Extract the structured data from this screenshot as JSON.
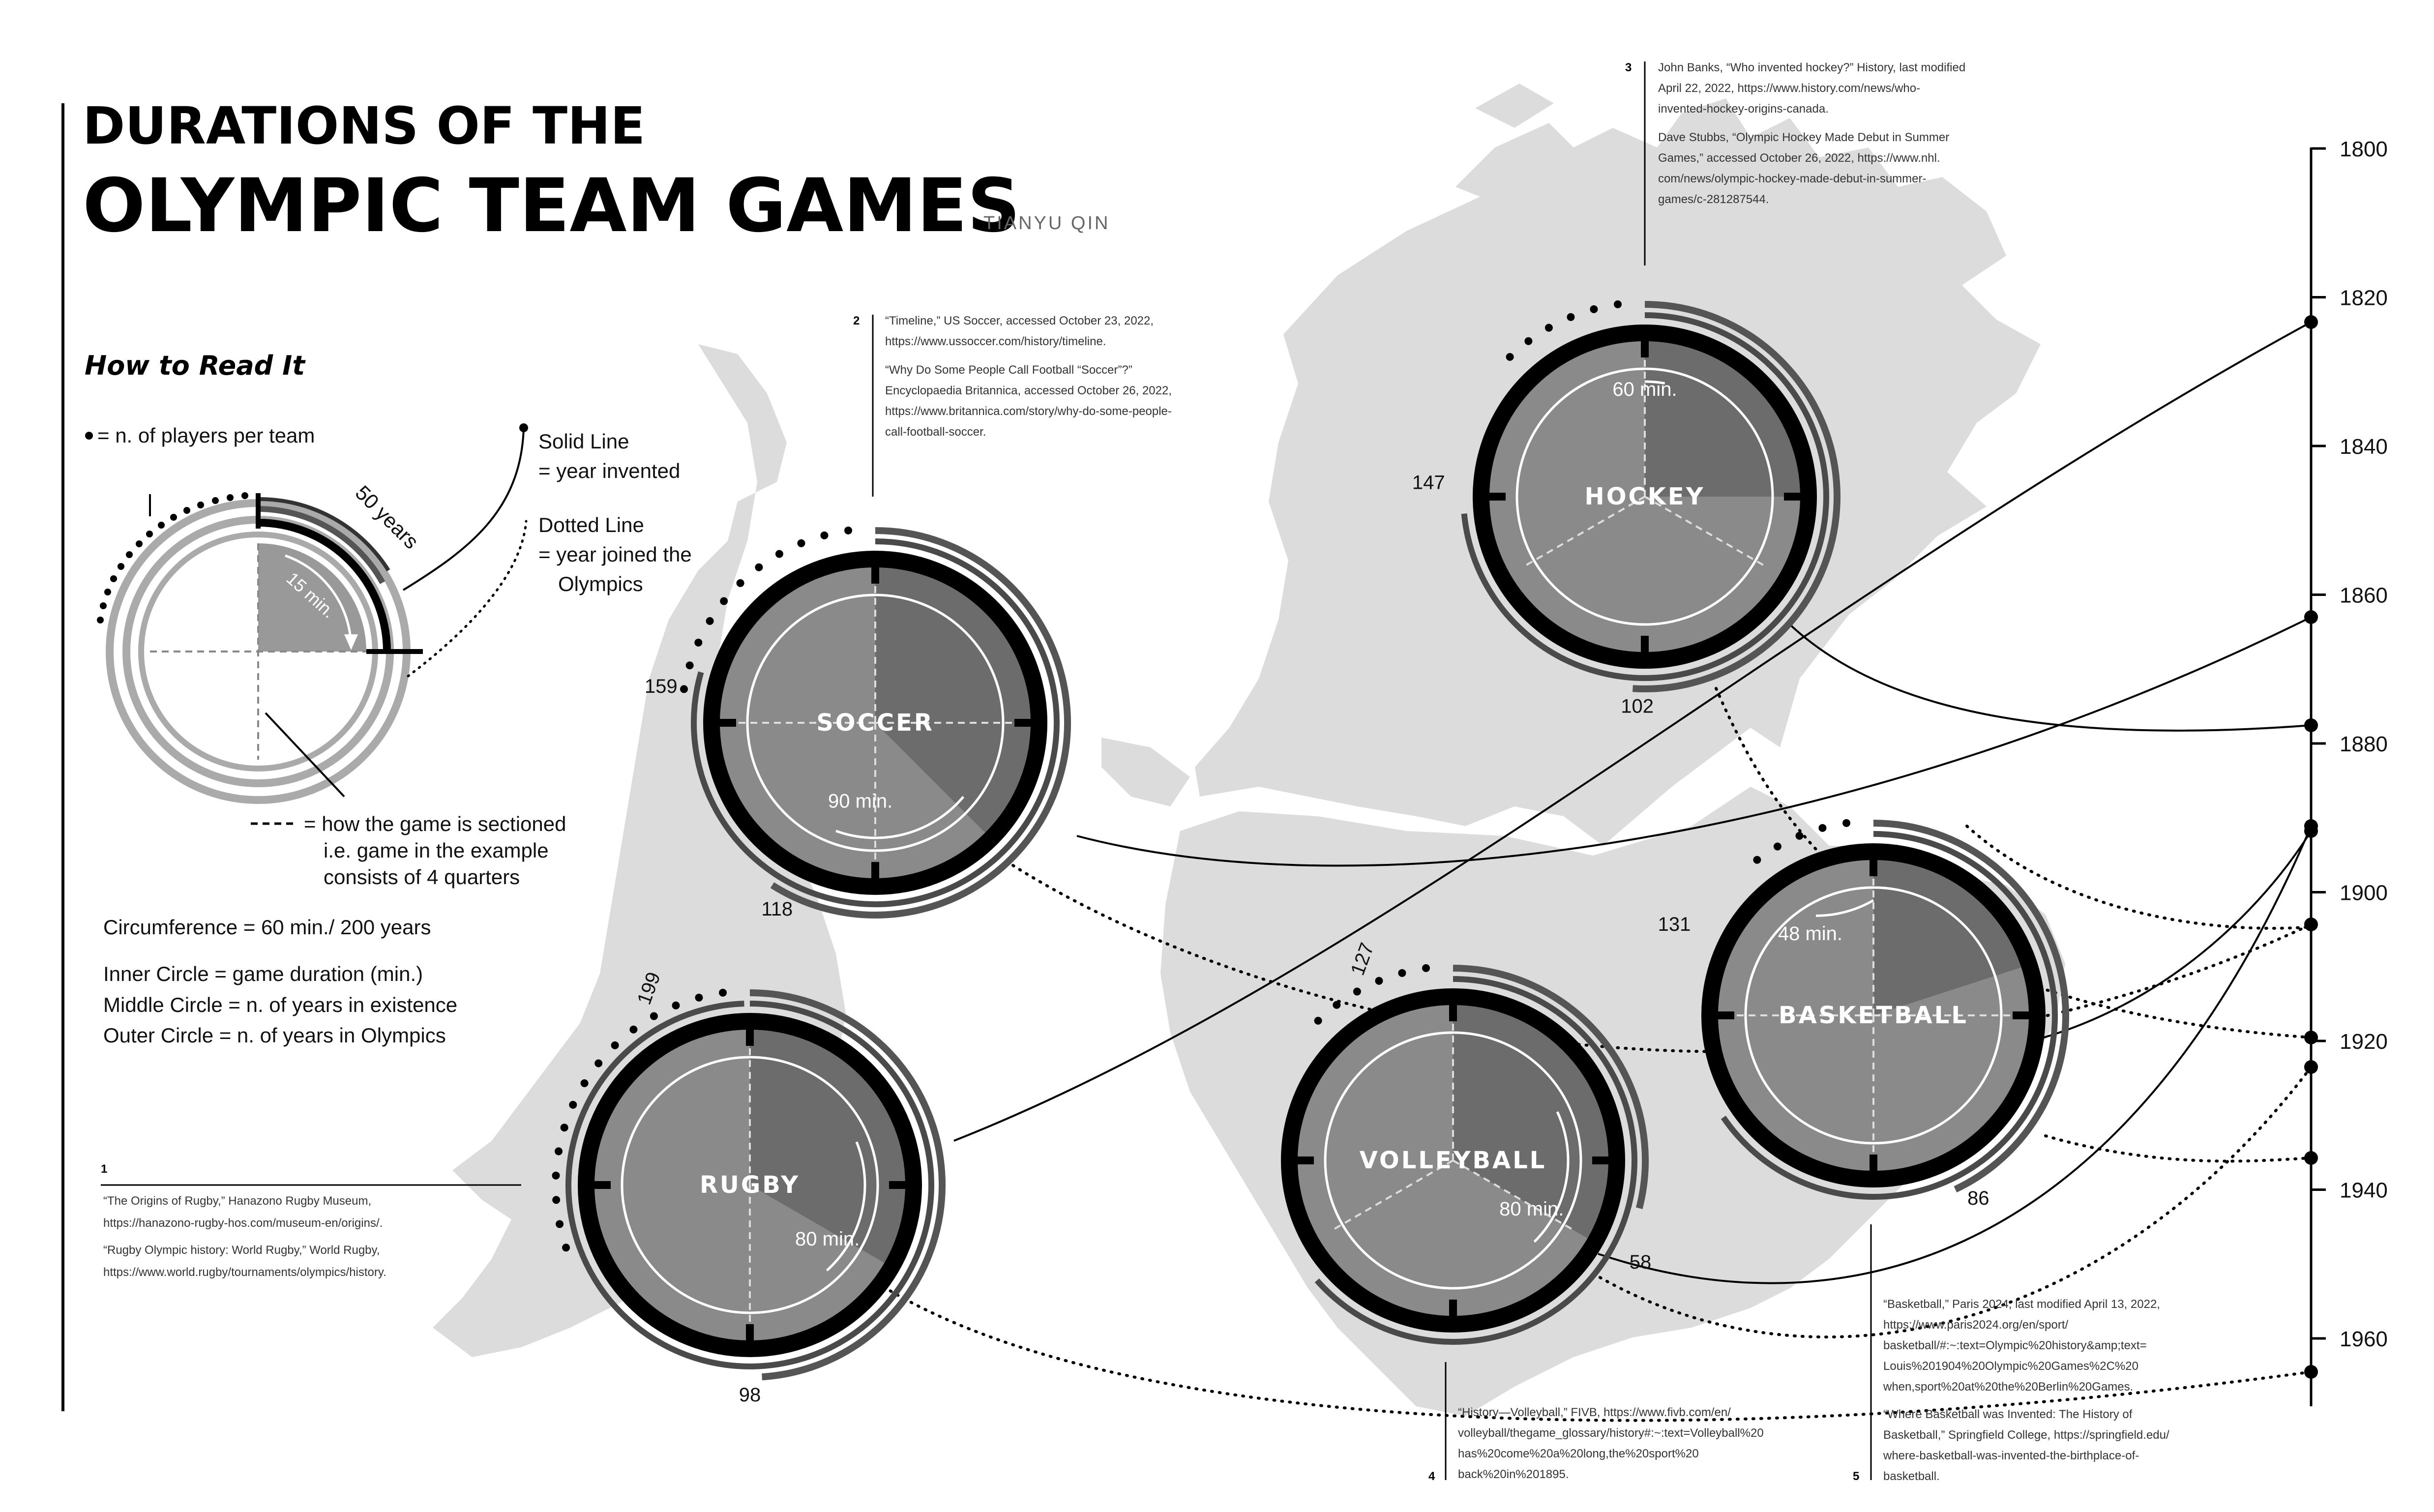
{
  "title": {
    "line1": "DURATIONS OF THE",
    "line2": "OLYMPIC TEAM GAMES",
    "author": "TIANYU QIN"
  },
  "how_to": {
    "heading": "How to Read It",
    "players": "= n. of players per team",
    "solid_line_1": "Solid Line",
    "solid_line_2": "= year invented",
    "dotted_line_1": "Dotted Line",
    "dotted_line_2": "= year joined the",
    "dotted_line_3": "Olympics",
    "sectioned_1": "= how the game is sectioned",
    "sectioned_2": "i.e.  game in the example",
    "sectioned_3": "consists of 4 quarters",
    "circumference": "Circumference =  60 min./ 200 years",
    "inner": "Inner  Circle = game duration (min.)",
    "middle": "Middle Circle = n. of years in existence",
    "outer": "Outer Circle = n. of years in Olympics",
    "example_years": "50 years",
    "example_min": "15 min."
  },
  "games": [
    {
      "name": "SOCCER",
      "duration": "90 min.",
      "existence": "159",
      "olympics": "118"
    },
    {
      "name": "HOCKEY",
      "duration": "60 min.",
      "existence": "147",
      "olympics": "102"
    },
    {
      "name": "RUGBY",
      "duration": "80 min.",
      "existence": "199",
      "olympics": "98"
    },
    {
      "name": "VOLLEYBALL",
      "duration": "80 min.",
      "existence": "127",
      "olympics": "58"
    },
    {
      "name": "BASKETBALL",
      "duration": "48 min.",
      "existence": "131",
      "olympics": "86"
    }
  ],
  "timeline": [
    "1800",
    "1820",
    "1840",
    "1860",
    "1880",
    "1900",
    "1920",
    "1940",
    "1960"
  ],
  "notes": {
    "n1": {
      "num": "1",
      "lines": [
        "“The Origins of Rugby,” Hanazono Rugby Museum,",
        "https://hanazono-rugby-hos.com/museum-en/origins/.",
        "“Rugby Olympic history: World Rugby,” World Rugby,",
        "https://www.world.rugby/tournaments/olympics/history."
      ]
    },
    "n2": {
      "num": "2",
      "lines": [
        "“Timeline,” US Soccer, accessed October 23, 2022,",
        "https://www.ussoccer.com/history/timeline.",
        "“Why Do Some People Call Football “Soccer”?”",
        "Encyclopaedia Britannica, accessed October 26, 2022,",
        "https://www.britannica.com/story/why-do-some-people-",
        "call-football-soccer."
      ]
    },
    "n3": {
      "num": "3",
      "lines": [
        "John Banks, “Who invented hockey?” History, last modified",
        "April 22, 2022, https://www.history.com/news/who-",
        "invented-hockey-origins-canada.",
        "Dave Stubbs, “Olympic Hockey Made Debut in Summer",
        "Games,” accessed October 26, 2022, https://www.nhl.",
        "com/news/olympic-hockey-made-debut-in-summer-",
        "games/c-281287544."
      ]
    },
    "n4": {
      "num": "4",
      "lines": [
        "“History—Volleyball,” FIVB, https://www.fivb.com/en/",
        "volleyball/thegame_glossary/history#:~:text=Volleyball%20",
        "has%20come%20a%20long,the%20sport%20",
        "back%20in%201895."
      ]
    },
    "n5": {
      "num": "5",
      "lines": [
        "“Basketball,” Paris 2024, last modified April 13, 2022,",
        "https://www.paris2024.org/en/sport/",
        "basketball/#:~:text=Olympic%20history&amp;text=",
        "Louis%201904%20Olympic%20Games%2C%20",
        "when,sport%20at%20the%20Berlin%20Games.",
        "“Where Basketball was Invented: The History of",
        "Basketball,” Springfield College, https://springfield.edu/",
        "where-basketball-was-invented-the-birthplace-of-",
        "basketball."
      ]
    }
  }
}
